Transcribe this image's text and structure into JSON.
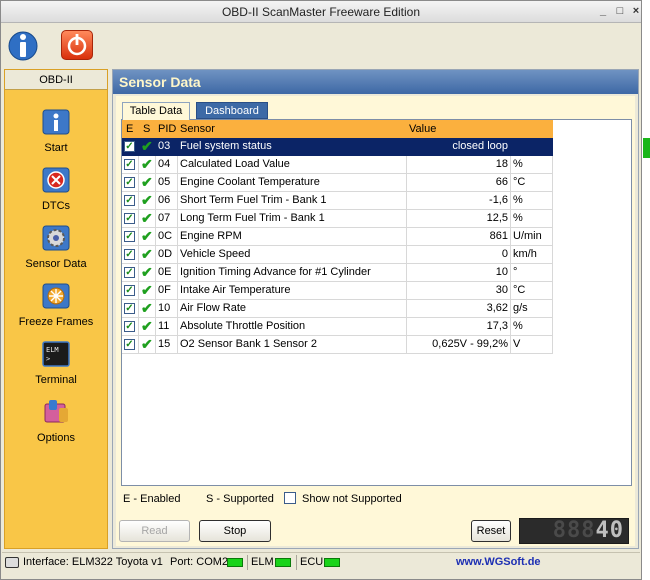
{
  "window": {
    "title": "OBD-II ScanMaster Freeware Edition"
  },
  "nav": {
    "header": "OBD-II",
    "items": [
      {
        "label": "Start",
        "icon": "info-icon",
        "color": "#3d78c8"
      },
      {
        "label": "DTCs",
        "icon": "error-icon",
        "color": "#d8281e"
      },
      {
        "label": "Sensor Data",
        "icon": "gear-icon",
        "color": "#4a5fa8"
      },
      {
        "label": "Freeze Frames",
        "icon": "snowflake-icon",
        "color": "#3c82cc"
      },
      {
        "label": "Terminal",
        "icon": "terminal-icon",
        "color": "#1b1b1b"
      },
      {
        "label": "Options",
        "icon": "options-icon",
        "color": "#3a7ad0"
      }
    ]
  },
  "main": {
    "header": "Sensor Data",
    "tabs": [
      {
        "label": "Table Data"
      },
      {
        "label": "Dashboard"
      }
    ],
    "columns": {
      "e": "E",
      "s": "S",
      "pid": "PID",
      "sensor": "Sensor",
      "value": "Value"
    },
    "rows": [
      {
        "pid": "03",
        "sensor": "Fuel system status",
        "value": "closed loop",
        "unit": ""
      },
      {
        "pid": "04",
        "sensor": "Calculated Load Value",
        "value": "18",
        "unit": "%"
      },
      {
        "pid": "05",
        "sensor": "Engine Coolant Temperature",
        "value": "66",
        "unit": "°C"
      },
      {
        "pid": "06",
        "sensor": "Short Term Fuel Trim - Bank 1",
        "value": "-1,6",
        "unit": "%"
      },
      {
        "pid": "07",
        "sensor": "Long Term Fuel Trim - Bank 1",
        "value": "12,5",
        "unit": "%"
      },
      {
        "pid": "0C",
        "sensor": "Engine RPM",
        "value": "861",
        "unit": "U/min"
      },
      {
        "pid": "0D",
        "sensor": "Vehicle Speed",
        "value": "0",
        "unit": "km/h"
      },
      {
        "pid": "0E",
        "sensor": "Ignition Timing Advance for #1 Cylinder",
        "value": "10",
        "unit": "°"
      },
      {
        "pid": "0F",
        "sensor": "Intake Air Temperature",
        "value": "30",
        "unit": "°C"
      },
      {
        "pid": "10",
        "sensor": "Air Flow Rate",
        "value": "3,62",
        "unit": "g/s"
      },
      {
        "pid": "11",
        "sensor": "Absolute Throttle Position",
        "value": "17,3",
        "unit": "%"
      },
      {
        "pid": "15",
        "sensor": "O2 Sensor Bank 1 Sensor 2",
        "value": "0,625V - 99,2%",
        "unit": "V"
      }
    ],
    "legend": {
      "enabled": "E - Enabled",
      "supported": "S - Supported",
      "show_not_supported": "Show not Supported"
    }
  },
  "buttons": {
    "read": "Read",
    "stop": "Stop",
    "reset": "Reset"
  },
  "lcd": {
    "dim": "888",
    "value": "40"
  },
  "status": {
    "interface": "Interface: ELM322 Toyota v1",
    "port": "Port: COM2",
    "elm": "ELM",
    "ecu": "ECU",
    "url": "www.WGSoft.de"
  }
}
